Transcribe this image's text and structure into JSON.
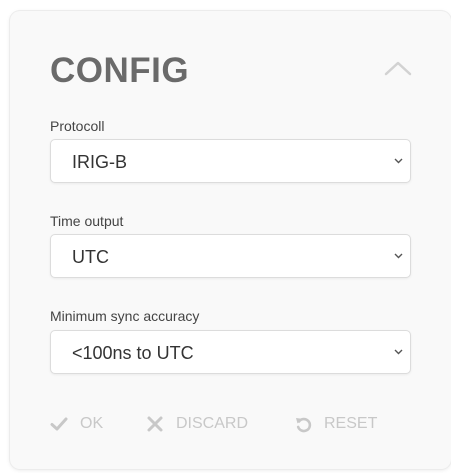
{
  "config": {
    "title": "CONFIG",
    "collapse_icon": "chevron-up-icon",
    "fields": [
      {
        "label": "Protocoll",
        "selected": "IRIG-B"
      },
      {
        "label": "Time output",
        "selected": "UTC"
      },
      {
        "label": "Minimum sync accuracy",
        "selected": "<100ns to UTC"
      }
    ],
    "actions": {
      "ok_label": "OK",
      "discard_label": "DISCARD",
      "reset_label": "RESET"
    },
    "colors": {
      "card_background": "#f9f9f9",
      "title": "#6a6a6a",
      "disabled_action": "#c8c8c8"
    }
  }
}
